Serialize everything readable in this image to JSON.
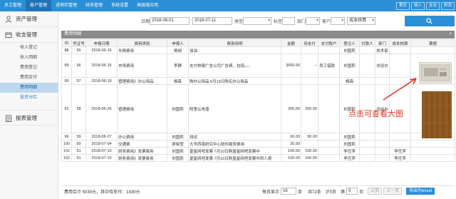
{
  "topbar": {
    "nav": [
      "员工管理",
      "客户管理",
      "进销存管理",
      "财务管理",
      "系统设置",
      "高级版应用"
    ],
    "active_index": 1,
    "buttons": [
      "首页",
      "收入",
      "支出",
      "利润"
    ],
    "accent_color": "#2b8fd6"
  },
  "sidebar": {
    "group1": "资产管理",
    "group2": "收支管理",
    "items": [
      "收入登记",
      "收入明细",
      "费用登记",
      "费用支付",
      "费用明细",
      "投资分红"
    ],
    "active_index": 4,
    "group3": "报表管理"
  },
  "filter": {
    "date_label": "日期",
    "date_from": "2018-06-01",
    "date_to": "2018-07-11",
    "type_label": "类型",
    "type_value": "",
    "tag_label": "标签",
    "dept_label": "部门",
    "customer_label": "客户",
    "cost_label": "成本核算"
  },
  "panel": {
    "title": "费用明细",
    "close": "×"
  },
  "table": {
    "headers": [
      "ID",
      "凭证号",
      "申报日期",
      "费用类别",
      "申报人",
      "费用说明",
      "金额",
      "待支付",
      "支付账户",
      "登记人",
      "付款人",
      "部门",
      "成本核算",
      "票据"
    ],
    "rows": [
      [
        "88",
        "55",
        "2018-06-15",
        "车辆费用",
        "杨勋",
        "加油",
        "",
        "",
        "",
        "刘国莉",
        "",
        "技术部",
        "",
        ""
      ],
      [
        "89",
        "56",
        "2018-06-15",
        "市场费用",
        "李静",
        "支付林德广告公司广告费，包括。。。",
        "3600.00",
        "--",
        "员工借款",
        "刘国莉",
        "",
        "总经办",
        "",
        "thumb"
      ],
      [
        "90",
        "57",
        "2018-06-19",
        "管理费用》办公用品",
        "杨森",
        "购办公用品 6月19日购买办公用品",
        "",
        "",
        "",
        "杨森",
        "",
        "",
        "",
        ""
      ],
      [
        "91",
        "58",
        "2018-06-26",
        "管理费用",
        "刘国莉",
        "阿里云充值",
        "300.00",
        "300.00",
        "",
        "刘国莉",
        "",
        "总经办",
        "",
        "thumb"
      ],
      [
        "96",
        "59",
        "2018-06-27",
        "办公费用",
        "刘国莉",
        "测试",
        "60.00",
        "50.00",
        "",
        "刘国莉",
        "",
        "",
        "",
        ""
      ],
      [
        "100",
        "60",
        "2018-07-04",
        "交通费",
        "廖晓莹",
        "大华西南研究中心软件服务费用",
        "20.00",
        "",
        "",
        "刘国莉",
        "",
        "",
        "",
        ""
      ],
      [
        "101",
        "61",
        "2018-07-10",
        "财务费用》发票费用",
        "刘国莉",
        "皇星网吧发票 7月10日购皇星网吧发票中",
        "100.00",
        "100.00",
        "",
        "李任萍",
        "",
        "",
        "李任萍",
        ""
      ],
      [
        "102",
        "61",
        "2018-07-10",
        "财务费用》发票费用",
        "刘国莉",
        "皇星网吧发票 7月10日购皇星网吧发票中同人费",
        "100.00",
        "100.00",
        "",
        "李任萍",
        "",
        "",
        "李任萍",
        ""
      ]
    ]
  },
  "annotation": "点击可查看大图",
  "footer": {
    "total": "费用合计 5030元，其中待支付：1430元",
    "per_page_label": "每页显示",
    "per_page": "16",
    "unit": "条",
    "total_count": "共72条",
    "page_info": "计5页",
    "page_label": "第",
    "page": "5",
    "page_suffix": "页",
    "prev": "上页",
    "next": "上一页",
    "export": "导出为excel"
  }
}
